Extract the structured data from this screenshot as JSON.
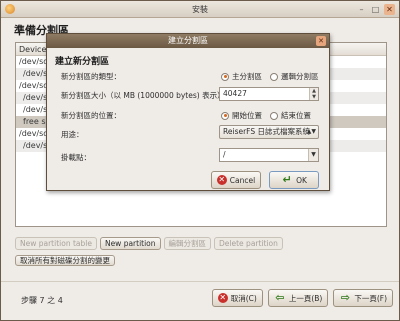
{
  "window": {
    "title": "安裝",
    "heading": "準備分割區",
    "buttons": [
      "–",
      "□",
      "✕"
    ]
  },
  "partition_list": {
    "header": "Device",
    "rows": [
      "/dev/sda",
      "/dev/sda",
      "/dev/sdb",
      "/dev/sdb",
      "/dev/sdb",
      "free spa",
      "/dev/sdc",
      "/dev/sdc"
    ]
  },
  "actions": {
    "new_table": "New partition table",
    "new_partition": "New partition",
    "edit": "編輯分割區",
    "delete": "Delete partition",
    "undo": "取消所有對磁碟分割的變更"
  },
  "footer": {
    "step": "步驟 7 之 4",
    "cancel": "取消(C)",
    "back": "上一頁(B)",
    "forward": "下一頁(F)"
  },
  "dialog": {
    "title": "建立分割區",
    "heading": "建立新分割區",
    "type_label": "新分割區的類型：",
    "type_primary": "主分割區",
    "type_logical": "邏輯分割區",
    "size_label": "新分割區大小（以 MB (1000000 bytes) 表示）：",
    "size_value": "40427",
    "location_label": "新分割區的位置：",
    "location_begin": "開始位置",
    "location_end": "結束位置",
    "use_label": "用途：",
    "use_value": "ReiserFS 日誌式檔案系統",
    "mount_label": "掛載點：",
    "mount_value": "/",
    "cancel": "Cancel",
    "ok": "OK",
    "close": "✕"
  },
  "colors": {
    "dialog_title_bar": "#7a6650",
    "radio_selected": "#d6681e",
    "cancel_icon": "#c9302c",
    "ok_icon": "#2f7a19"
  }
}
